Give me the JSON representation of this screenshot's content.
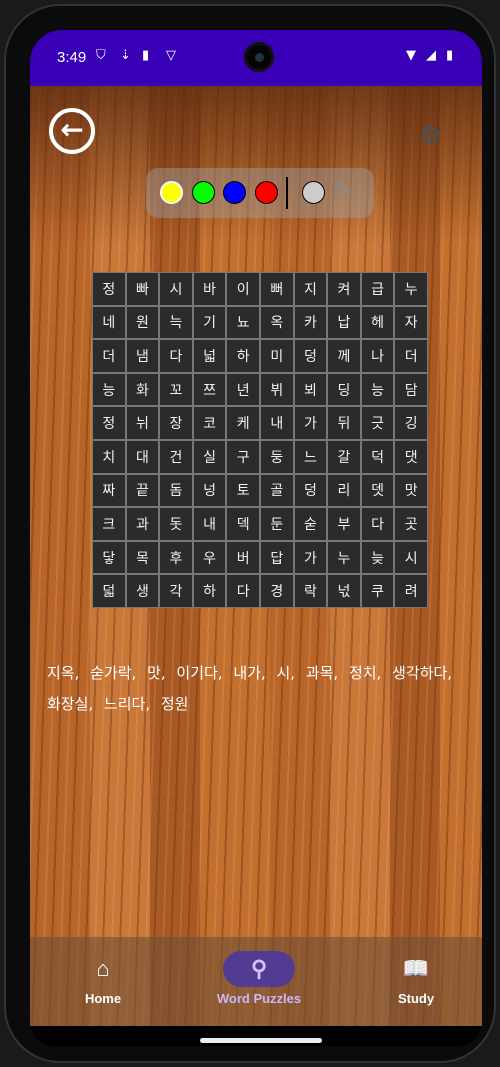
{
  "status_bar": {
    "time": "3:49",
    "icons": [
      "shield-icon",
      "download-icon",
      "sd-card-icon",
      "vpn-icon"
    ],
    "right_icons": [
      "wifi-icon",
      "signal-icon",
      "battery-icon"
    ],
    "color": "#3a00b8"
  },
  "toolbar": {
    "back_icon": "arrow-left-circle-icon",
    "settings_icon": "gear-icon",
    "colors": [
      {
        "name": "yellow",
        "hex": "#ffff00",
        "selected": true
      },
      {
        "name": "green",
        "hex": "#00ff00"
      },
      {
        "name": "blue",
        "hex": "#0000ff"
      },
      {
        "name": "red",
        "hex": "#ff0000"
      }
    ],
    "eraser_color": "#cccccc",
    "pencil_icon": "pencil-icon"
  },
  "grid": [
    [
      "정",
      "빠",
      "시",
      "바",
      "이",
      "뻐",
      "지",
      "켜",
      "급",
      "누"
    ],
    [
      "네",
      "원",
      "늑",
      "기",
      "뇨",
      "옥",
      "카",
      "납",
      "헤",
      "자"
    ],
    [
      "더",
      "냄",
      "다",
      "넓",
      "하",
      "미",
      "덩",
      "께",
      "나",
      "더"
    ],
    [
      "능",
      "화",
      "꼬",
      "쯔",
      "년",
      "뷔",
      "뵈",
      "딩",
      "능",
      "담"
    ],
    [
      "정",
      "뉘",
      "장",
      "코",
      "케",
      "내",
      "가",
      "뒤",
      "긋",
      "깅"
    ],
    [
      "치",
      "대",
      "건",
      "실",
      "구",
      "둥",
      "느",
      "갈",
      "덕",
      "댓"
    ],
    [
      "짜",
      "끝",
      "돔",
      "넝",
      "토",
      "골",
      "덩",
      "리",
      "뎃",
      "맛"
    ],
    [
      "크",
      "과",
      "돗",
      "내",
      "덱",
      "둔",
      "숟",
      "부",
      "다",
      "곳"
    ],
    [
      "닿",
      "목",
      "후",
      "우",
      "버",
      "답",
      "가",
      "누",
      "늦",
      "시"
    ],
    [
      "덟",
      "생",
      "각",
      "하",
      "다",
      "경",
      "락",
      "넋",
      "쿠",
      "려"
    ]
  ],
  "words_text": "지옥, 숟가락, 맛, 이기다, 내가, 시, 과목, 정치, 생각하다, 화장실, 느리다, 정원",
  "nav": {
    "items": [
      {
        "label": "Home",
        "icon": "home-icon"
      },
      {
        "label": "Word Puzzles",
        "icon": "search-icon",
        "active": true
      },
      {
        "label": "Study",
        "icon": "book-icon"
      }
    ],
    "active_color": "#523b92"
  }
}
